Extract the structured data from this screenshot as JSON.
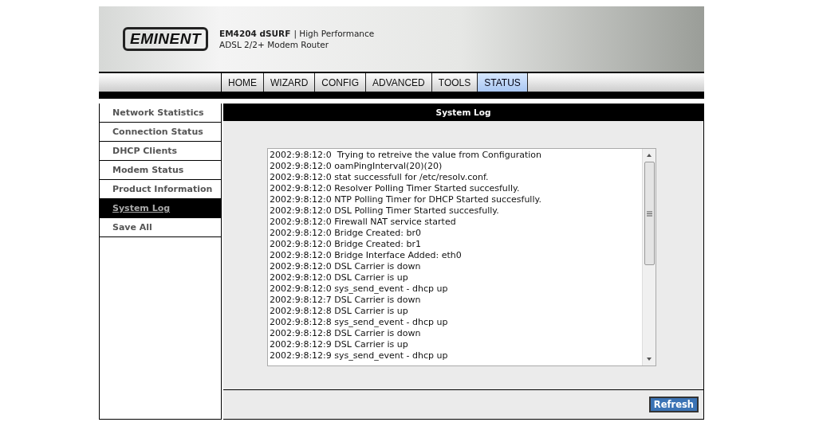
{
  "header": {
    "logo": "EMINENT",
    "product": "EM4204 dSURF",
    "tagline": "| High Performance",
    "subtitle": "ADSL 2/2+ Modem Router"
  },
  "tabs": [
    {
      "label": "HOME",
      "selected": false
    },
    {
      "label": "WIZARD",
      "selected": false
    },
    {
      "label": "CONFIG",
      "selected": false
    },
    {
      "label": "ADVANCED",
      "selected": false
    },
    {
      "label": "TOOLS",
      "selected": false
    },
    {
      "label": "STATUS",
      "selected": true
    }
  ],
  "sidebar": {
    "items": [
      {
        "label": "Network Statistics",
        "selected": false
      },
      {
        "label": "Connection Status",
        "selected": false
      },
      {
        "label": "DHCP Clients",
        "selected": false
      },
      {
        "label": "Modem Status",
        "selected": false
      },
      {
        "label": "Product Information",
        "selected": false
      },
      {
        "label": "System Log",
        "selected": true
      },
      {
        "label": "Save All",
        "selected": false
      }
    ]
  },
  "panel": {
    "title": "System Log",
    "log": [
      "2002:9:8:12:0  Trying to retreive the value from Configuration",
      "2002:9:8:12:0 oamPingInterval(20)(20)",
      "2002:9:8:12:0 stat successfull for /etc/resolv.conf.",
      "2002:9:8:12:0 Resolver Polling Timer Started succesfully.",
      "2002:9:8:12:0 NTP Polling Timer for DHCP Started succesfully.",
      "2002:9:8:12:0 DSL Polling Timer Started succesfully.",
      "2002:9:8:12:0 Firewall NAT service started",
      "2002:9:8:12:0 Bridge Created: br0",
      "2002:9:8:12:0 Bridge Created: br1",
      "2002:9:8:12:0 Bridge Interface Added: eth0",
      "2002:9:8:12:0 DSL Carrier is down",
      "2002:9:8:12:0 DSL Carrier is up",
      "2002:9:8:12:0 sys_send_event - dhcp up",
      "2002:9:8:12:7 DSL Carrier is down",
      "2002:9:8:12:8 DSL Carrier is up",
      "2002:9:8:12:8 sys_send_event - dhcp up",
      "2002:9:8:12:8 DSL Carrier is down",
      "2002:9:8:12:9 DSL Carrier is up",
      "2002:9:8:12:9 sys_send_event - dhcp up"
    ],
    "button": "Refresh"
  }
}
